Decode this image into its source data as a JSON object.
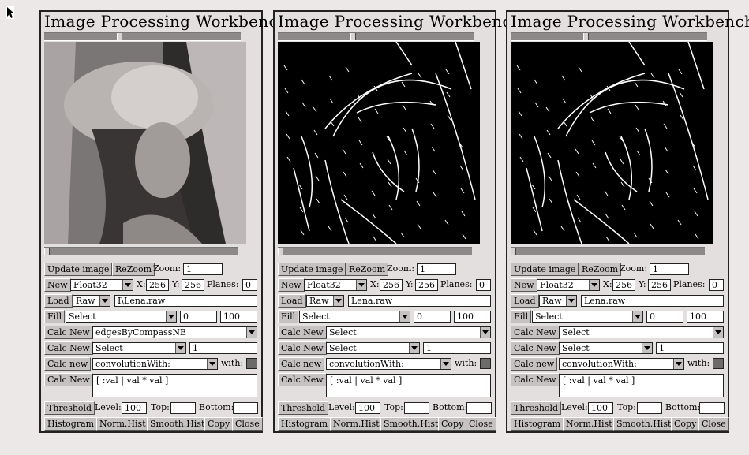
{
  "windows": [
    {
      "title": "Image Processing Workbench",
      "buttons": {
        "update": "Update image",
        "rezoom": "ReZoom",
        "new": "New",
        "load": "Load",
        "fill": "Fill",
        "calc1": "Calc New",
        "calc2": "Calc New",
        "calc3": "Calc new",
        "calc4": "Calc New",
        "threshold": "Threshold",
        "histogram": "Histogram",
        "normhist": "Norm.Hist",
        "smoothhist": "Smooth.Hist",
        "copy": "Copy",
        "close": "Close"
      },
      "labels": {
        "zoom": "Zoom:",
        "x": "X:",
        "y": "Y:",
        "planes": "Planes:",
        "with": "with:",
        "level": "Level:",
        "top": "Top:",
        "bottom": "Bottom:"
      },
      "values": {
        "zoom": "1",
        "type": "Float32",
        "x": "256",
        "y": "256",
        "planes": "0",
        "format": "Raw",
        "file": "I\\Lena.raw",
        "fill_select": "Select",
        "fill_min": "0",
        "fill_max": "100",
        "calc1_select": "edgesByCompassNE",
        "calc2_select": "Select",
        "calc2_val": "1",
        "calc3_select": "convolutionWith:",
        "expr": "[ :val | val * val ]",
        "level": "100",
        "top": "",
        "bottom": ""
      },
      "image": "original"
    },
    {
      "title": "Image Processing Workbench",
      "buttons": {
        "update": "Update image",
        "rezoom": "ReZoom",
        "new": "New",
        "load": "Load",
        "fill": "Fill",
        "calc1": "Calc New",
        "calc2": "Calc New",
        "calc3": "Calc new",
        "calc4": "Calc New",
        "threshold": "Threshold",
        "histogram": "Histogram",
        "normhist": "Norm.Hist",
        "smoothhist": "Smooth.Hist",
        "copy": "Copy",
        "close": "Close"
      },
      "labels": {
        "zoom": "Zoom:",
        "x": "X:",
        "y": "Y:",
        "planes": "Planes:",
        "with": "with:",
        "level": "Level:",
        "top": "Top:",
        "bottom": "Bottom:"
      },
      "values": {
        "zoom": "1",
        "type": "Float32",
        "x": "256",
        "y": "256",
        "planes": "0",
        "format": "Raw",
        "file": "Lena.raw",
        "fill_select": "Select",
        "fill_min": "0",
        "fill_max": "100",
        "calc1_select": "Select",
        "calc2_select": "Select",
        "calc2_val": "1",
        "calc3_select": "convolutionWith:",
        "expr": "[ :val | val * val ]",
        "level": "100",
        "top": "",
        "bottom": ""
      },
      "image": "edges"
    },
    {
      "title": "Image Processing Workbench",
      "buttons": {
        "update": "Update image",
        "rezoom": "ReZoom",
        "new": "New",
        "load": "Load",
        "fill": "Fill",
        "calc1": "Calc New",
        "calc2": "Calc New",
        "calc3": "Calc new",
        "calc4": "Calc New",
        "threshold": "Threshold",
        "histogram": "Histogram",
        "normhist": "Norm.Hist",
        "smoothhist": "Smooth.Hist",
        "copy": "Copy",
        "close": "Close"
      },
      "labels": {
        "zoom": "Zoom:",
        "x": "X:",
        "y": "Y:",
        "planes": "Planes:",
        "with": "with:",
        "level": "Level:",
        "top": "Top:",
        "bottom": "Bottom:"
      },
      "values": {
        "zoom": "1",
        "type": "Float32",
        "x": "256",
        "y": "256",
        "planes": "0",
        "format": "Raw",
        "file": "Lena.raw",
        "fill_select": "Select",
        "fill_min": "0",
        "fill_max": "100",
        "calc1_select": "Select",
        "calc2_select": "Select",
        "calc2_val": "1",
        "calc3_select": "convolutionWith:",
        "expr": "[ :val | val * val ]",
        "level": "100",
        "top": "",
        "bottom": ""
      },
      "image": "edges"
    }
  ]
}
